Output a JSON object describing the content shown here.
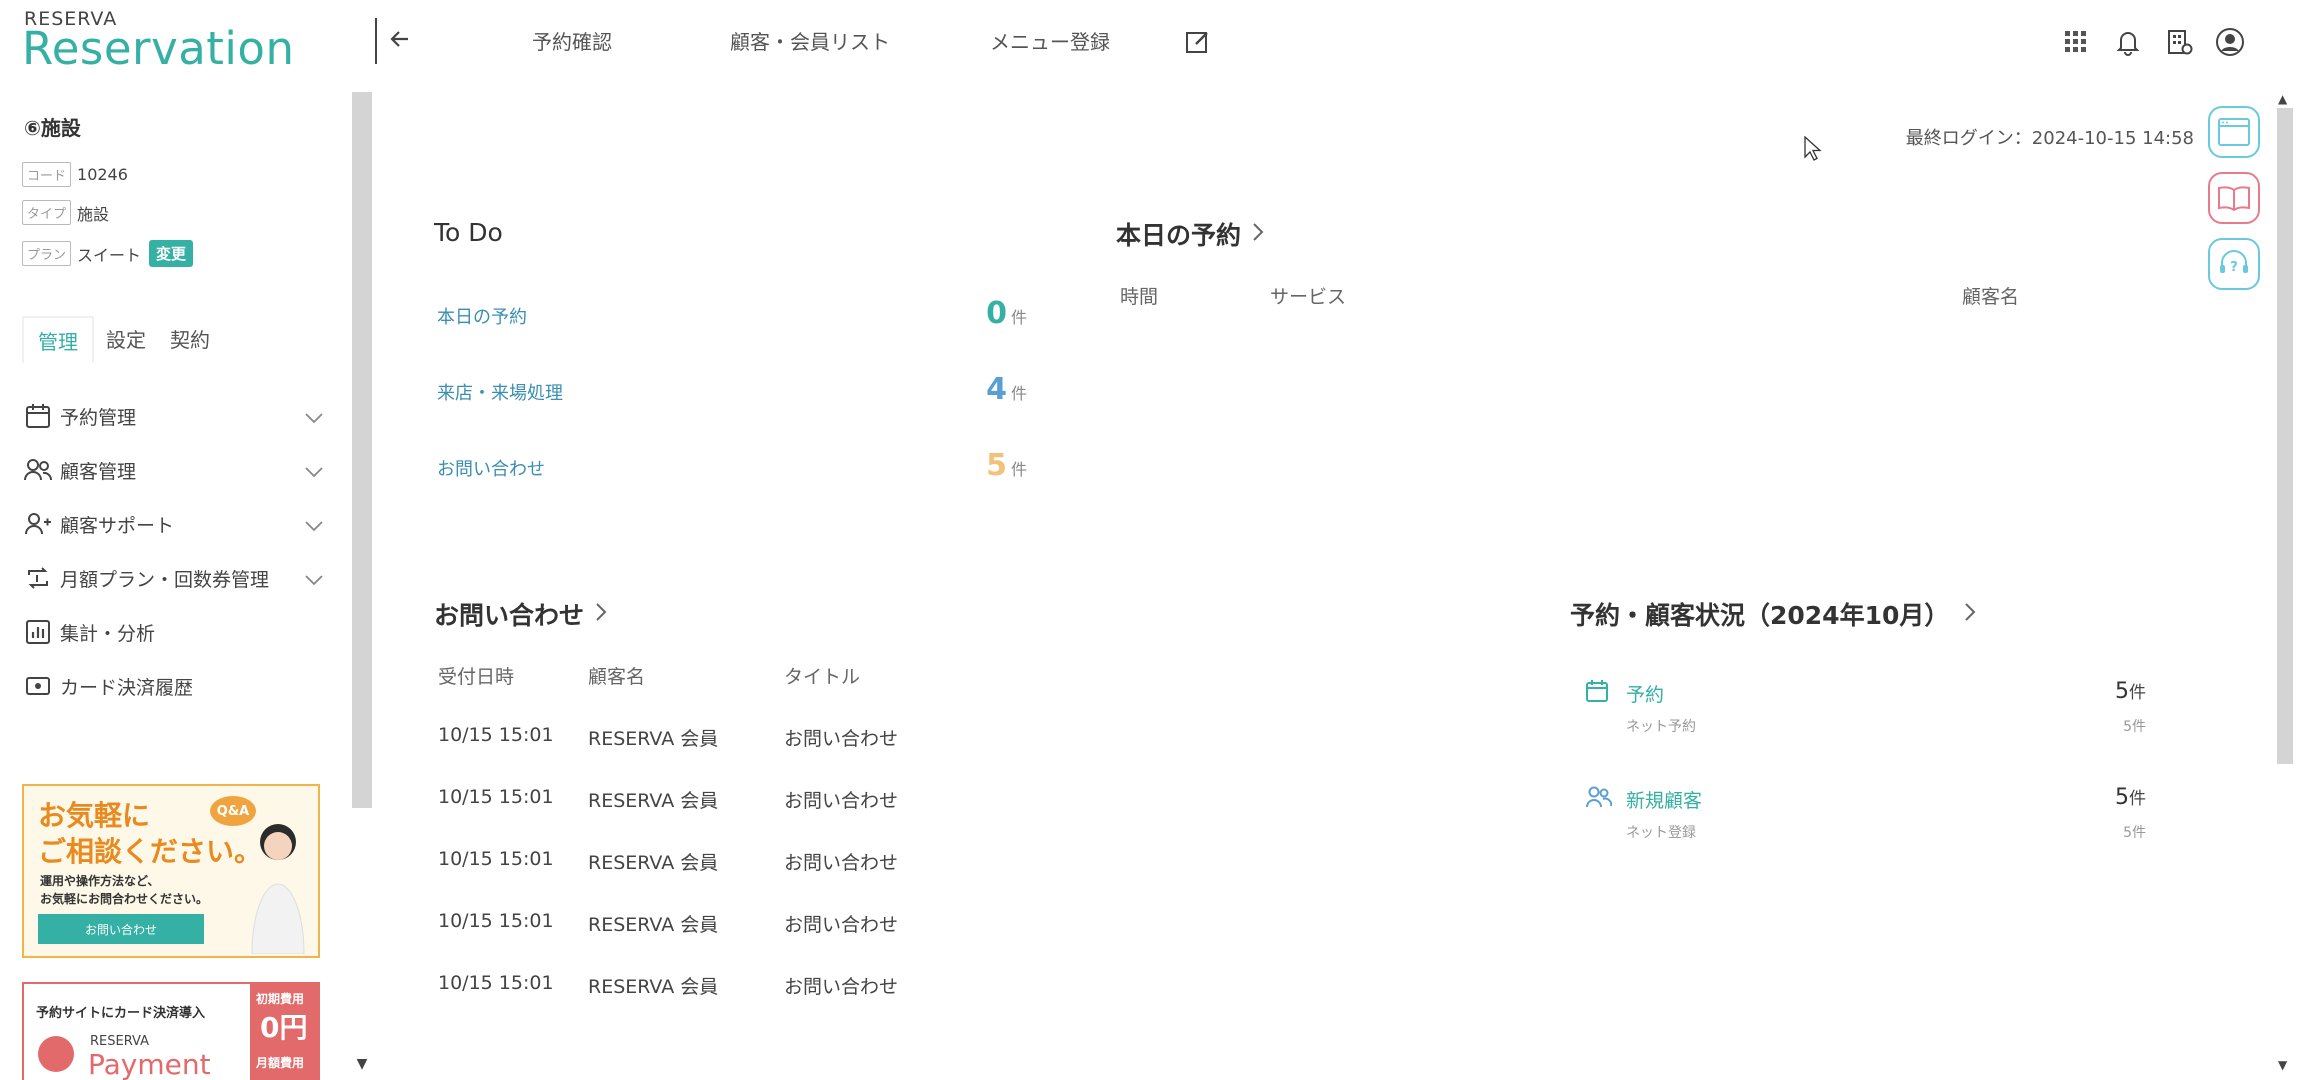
{
  "header": {
    "brand_small": "RESERVA",
    "brand_big": "Reservation",
    "nav": [
      "予約確認",
      "顧客・会員リスト",
      "メニュー登録"
    ]
  },
  "sidebar": {
    "facility_name": "⑥施設",
    "info": [
      {
        "label": "コード",
        "value": "10246"
      },
      {
        "label": "タイプ",
        "value": "施設"
      },
      {
        "label": "プラン",
        "value": "スイート",
        "badge": "変更"
      }
    ],
    "tabs": [
      "管理",
      "設定",
      "契約"
    ],
    "menu": [
      {
        "label": "予約管理",
        "icon": "calendar-icon",
        "chevron": true
      },
      {
        "label": "顧客管理",
        "icon": "users-icon",
        "chevron": true
      },
      {
        "label": "顧客サポート",
        "icon": "user-plus-icon",
        "chevron": true
      },
      {
        "label": "月額プラン・回数券管理",
        "icon": "repeat-icon",
        "chevron": true
      },
      {
        "label": "集計・分析",
        "icon": "chart-icon",
        "chevron": false
      },
      {
        "label": "カード決済履歴",
        "icon": "card-icon",
        "chevron": false
      }
    ],
    "banner1": {
      "line1": "お気軽に",
      "line2": "ご相談ください。",
      "tag": "Q&A",
      "desc1": "運用や操作方法など、",
      "desc2": "お気軽にお問合わせください。",
      "button": "お問い合わせ"
    },
    "banner2": {
      "title": "予約サイトにカード決済導入",
      "brand_small": "RESERVA",
      "brand": "Payment",
      "fee1": "初期費用",
      "fee1_val": "0円",
      "fee2": "月額費用"
    }
  },
  "main": {
    "last_login": "最終ログイン：2024-10-15 14:58",
    "todo": {
      "title": "To Do",
      "items": [
        {
          "label": "本日の予約",
          "count": "0",
          "unit": "件",
          "color": "#34b0a4"
        },
        {
          "label": "来店・来場処理",
          "count": "4",
          "unit": "件",
          "color": "#5a9fd4"
        },
        {
          "label": "お問い合わせ",
          "count": "5",
          "unit": "件",
          "color": "#f2c27a"
        }
      ]
    },
    "today": {
      "title": "本日の予約",
      "headers": [
        "時間",
        "サービス",
        "顧客名"
      ]
    },
    "inquiries": {
      "title": "お問い合わせ",
      "headers": [
        "受付日時",
        "顧客名",
        "タイトル"
      ],
      "rows": [
        [
          "10/15 15:01",
          "RESERVA 会員",
          "お問い合わせ"
        ],
        [
          "10/15 15:01",
          "RESERVA 会員",
          "お問い合わせ"
        ],
        [
          "10/15 15:01",
          "RESERVA 会員",
          "お問い合わせ"
        ],
        [
          "10/15 15:01",
          "RESERVA 会員",
          "お問い合わせ"
        ],
        [
          "10/15 15:01",
          "RESERVA 会員",
          "お問い合わせ"
        ]
      ]
    },
    "status": {
      "title": "予約・顧客状況（2024年10月）",
      "items": [
        {
          "label": "予約",
          "sub": "ネット予約",
          "count": "5",
          "unit": "件",
          "sub_count": "5",
          "sub_unit": "件",
          "icon": "calendar-icon"
        },
        {
          "label": "新規顧客",
          "sub": "ネット登録",
          "count": "5",
          "unit": "件",
          "sub_count": "5",
          "sub_unit": "件",
          "icon": "users-icon"
        }
      ]
    }
  },
  "colors": {
    "accent": "#34b0a4",
    "blue": "#5a9fd4",
    "orange": "#f2c27a",
    "red": "#e36a6a"
  }
}
